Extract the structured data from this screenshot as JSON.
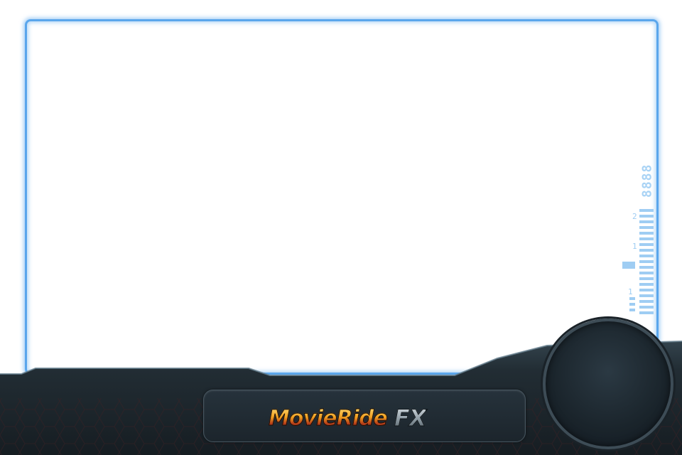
{
  "hud": {
    "readout": "8888",
    "gauge_label_top": "2",
    "gauge_label_mid": "1",
    "gauge_label_low": "1"
  },
  "logo": {
    "main": "MovieRide",
    "suffix": "FX"
  },
  "colors": {
    "frame_glow": "#5aa6ec",
    "hud": "#a9d3f5",
    "panel": "#1c262d",
    "logo_gold": "#f0a020"
  },
  "icons": {
    "record_button": "round-record-button"
  }
}
